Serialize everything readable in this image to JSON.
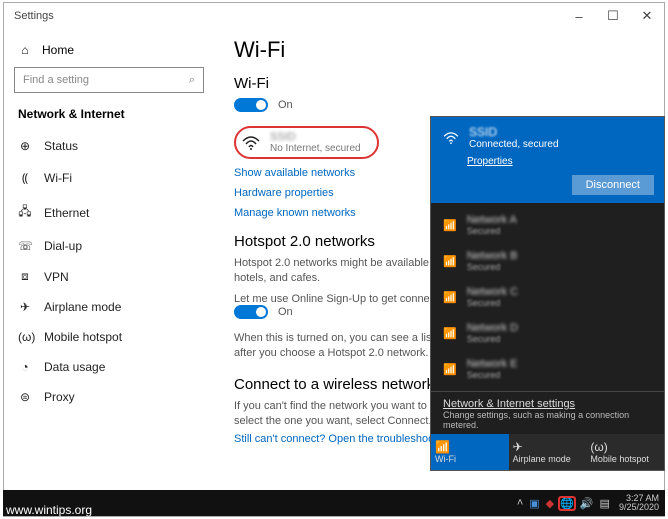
{
  "window": {
    "title": "Settings"
  },
  "sidebar": {
    "home": "Home",
    "search_placeholder": "Find a setting",
    "section": "Network & Internet",
    "items": [
      {
        "label": "Status"
      },
      {
        "label": "Wi-Fi"
      },
      {
        "label": "Ethernet"
      },
      {
        "label": "Dial-up"
      },
      {
        "label": "VPN"
      },
      {
        "label": "Airplane mode"
      },
      {
        "label": "Mobile hotspot"
      },
      {
        "label": "Data usage"
      },
      {
        "label": "Proxy"
      }
    ]
  },
  "content": {
    "h1": "Wi-Fi",
    "wifi_label": "Wi-Fi",
    "wifi_toggle_state": "On",
    "connection": {
      "name": "SSID",
      "status": "No Internet, secured"
    },
    "links": {
      "show_available": "Show available networks",
      "hw_props": "Hardware properties",
      "manage_known": "Manage known networks"
    },
    "hotspot": {
      "heading": "Hotspot 2.0 networks",
      "desc1": "Hotspot 2.0 networks might be available in certain public places, like airports, hotels, and cafes.",
      "toggle_label": "Let me use Online Sign-Up to get connected",
      "toggle_state": "On",
      "desc2": "When this is turned on, you can see a list of network providers for Online Sign-Up after you choose a Hotspot 2.0 network."
    },
    "connect": {
      "heading": "Connect to a wireless network",
      "desc": "If you can't find the network you want to connect to, select Show available networks, select the one you want, select Connect.",
      "troubleshoot": "Still can't connect? Open the troubleshooter"
    }
  },
  "flyout": {
    "current": {
      "name": "SSID",
      "status": "Connected, secured",
      "properties": "Properties",
      "disconnect": "Disconnect"
    },
    "networks": [
      {
        "name": "Network A",
        "sub": "Secured"
      },
      {
        "name": "Network B",
        "sub": "Secured"
      },
      {
        "name": "Network C",
        "sub": "Secured"
      },
      {
        "name": "Network D",
        "sub": "Secured"
      },
      {
        "name": "Network E",
        "sub": "Secured"
      }
    ],
    "settings": {
      "title": "Network & Internet settings",
      "desc": "Change settings, such as making a connection metered."
    },
    "quick": {
      "wifi": "Wi-Fi",
      "airplane": "Airplane mode",
      "hotspot": "Mobile hotspot"
    }
  },
  "taskbar": {
    "time": "3:27 AM",
    "date": "9/25/2020"
  },
  "watermark": "www.wintips.org"
}
